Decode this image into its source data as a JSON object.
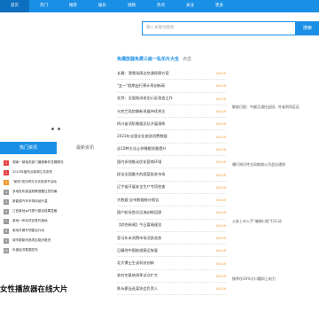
{
  "nav": [
    "首页",
    "热门",
    "推荐",
    "娱乐",
    "视频",
    "热点",
    "关注",
    "更多",
    "",
    "",
    ""
  ],
  "search": {
    "placeholder": "输入关键词搜索",
    "button": "搜索"
  },
  "hot": {
    "tabs": [
      "热门资讯",
      "最新资讯"
    ],
    "items": [
      {
        "num": "1",
        "text": "湖南一镇相关部门通报事件进展情况"
      },
      {
        "num": "2",
        "text": "2023年度热点新闻汇总发布"
      },
      {
        "num": "3",
        "text": "\"某地\"成功举办文化旅游节活动"
      },
      {
        "num": "4",
        "text": "多地发布高温预警提醒注意防暑"
      },
      {
        "num": "5",
        "text": "新能源汽车市场持续升温"
      },
      {
        "num": "6",
        "text": "江西某地乡村振兴建设成果显著"
      },
      {
        "num": "7",
        "text": "某地一体化项目签约落地"
      },
      {
        "num": "8",
        "text": "某地开展专项整治行动"
      },
      {
        "num": "9",
        "text": "城市更新改造项目稳步推进"
      },
      {
        "num": "10",
        "text": "年度经济数据发布"
      }
    ]
  },
  "section_title": "女性播放器在线大片",
  "main": {
    "title": "免播放器免费三级一乱伦片大全",
    "subtitle": "点击",
    "items": [
      {
        "text": "长春：滑雪场周边交通保障方案",
        "date": "08-09"
      },
      {
        "text": "\"五一\"假期出行预计再创新高",
        "date": "08-09"
      },
      {
        "text": "北京：全面推进老旧小区改造工作",
        "date": "08-09"
      },
      {
        "text": "乌克兰局势最新进展持续关注",
        "date": "08-09"
      },
      {
        "text": "四川省消防救援总队开展演练",
        "date": "08-09"
      },
      {
        "text": "2023年全国文化旅游消费数据",
        "date": "08-09"
      },
      {
        "text": "这10种方法让你睡眠质量提升",
        "date": "08-09"
      },
      {
        "text": "国内多地推动优化营商环境",
        "date": "08-09"
      },
      {
        "text": "探访全国最大的蔬菜批发市场",
        "date": "08-09"
      },
      {
        "text": "辽宁省开展安全生产专项检查",
        "date": "08-09"
      },
      {
        "text": "大数据·全市数据统计报告",
        "date": "08-09"
      },
      {
        "text": "国产航母首次远海训练回顾",
        "date": "08-09"
      },
      {
        "text": "【综合新闻】今日要闻速览",
        "date": "08-09"
      },
      {
        "text": "室马年末消费市场活跃态势",
        "date": "08-09"
      },
      {
        "text": "日精地中国航线客运恢复",
        "date": "08-09"
      },
      {
        "text": "北大博士生谈科技创新",
        "date": "08-09"
      },
      {
        "text": "农村宅基地改革试点扩大",
        "date": "08-09"
      },
      {
        "text": "陈永豪当选某协会负责人",
        "date": "08-09"
      }
    ]
  },
  "side": [
    "解放日报：中越互通往返班，外省到同区区",
    "儒行知识传业局联络公司会议通知",
    "公安上市入手\"偏制口役\"行行动",
    "陕师仅30%大口籍同上电力"
  ]
}
